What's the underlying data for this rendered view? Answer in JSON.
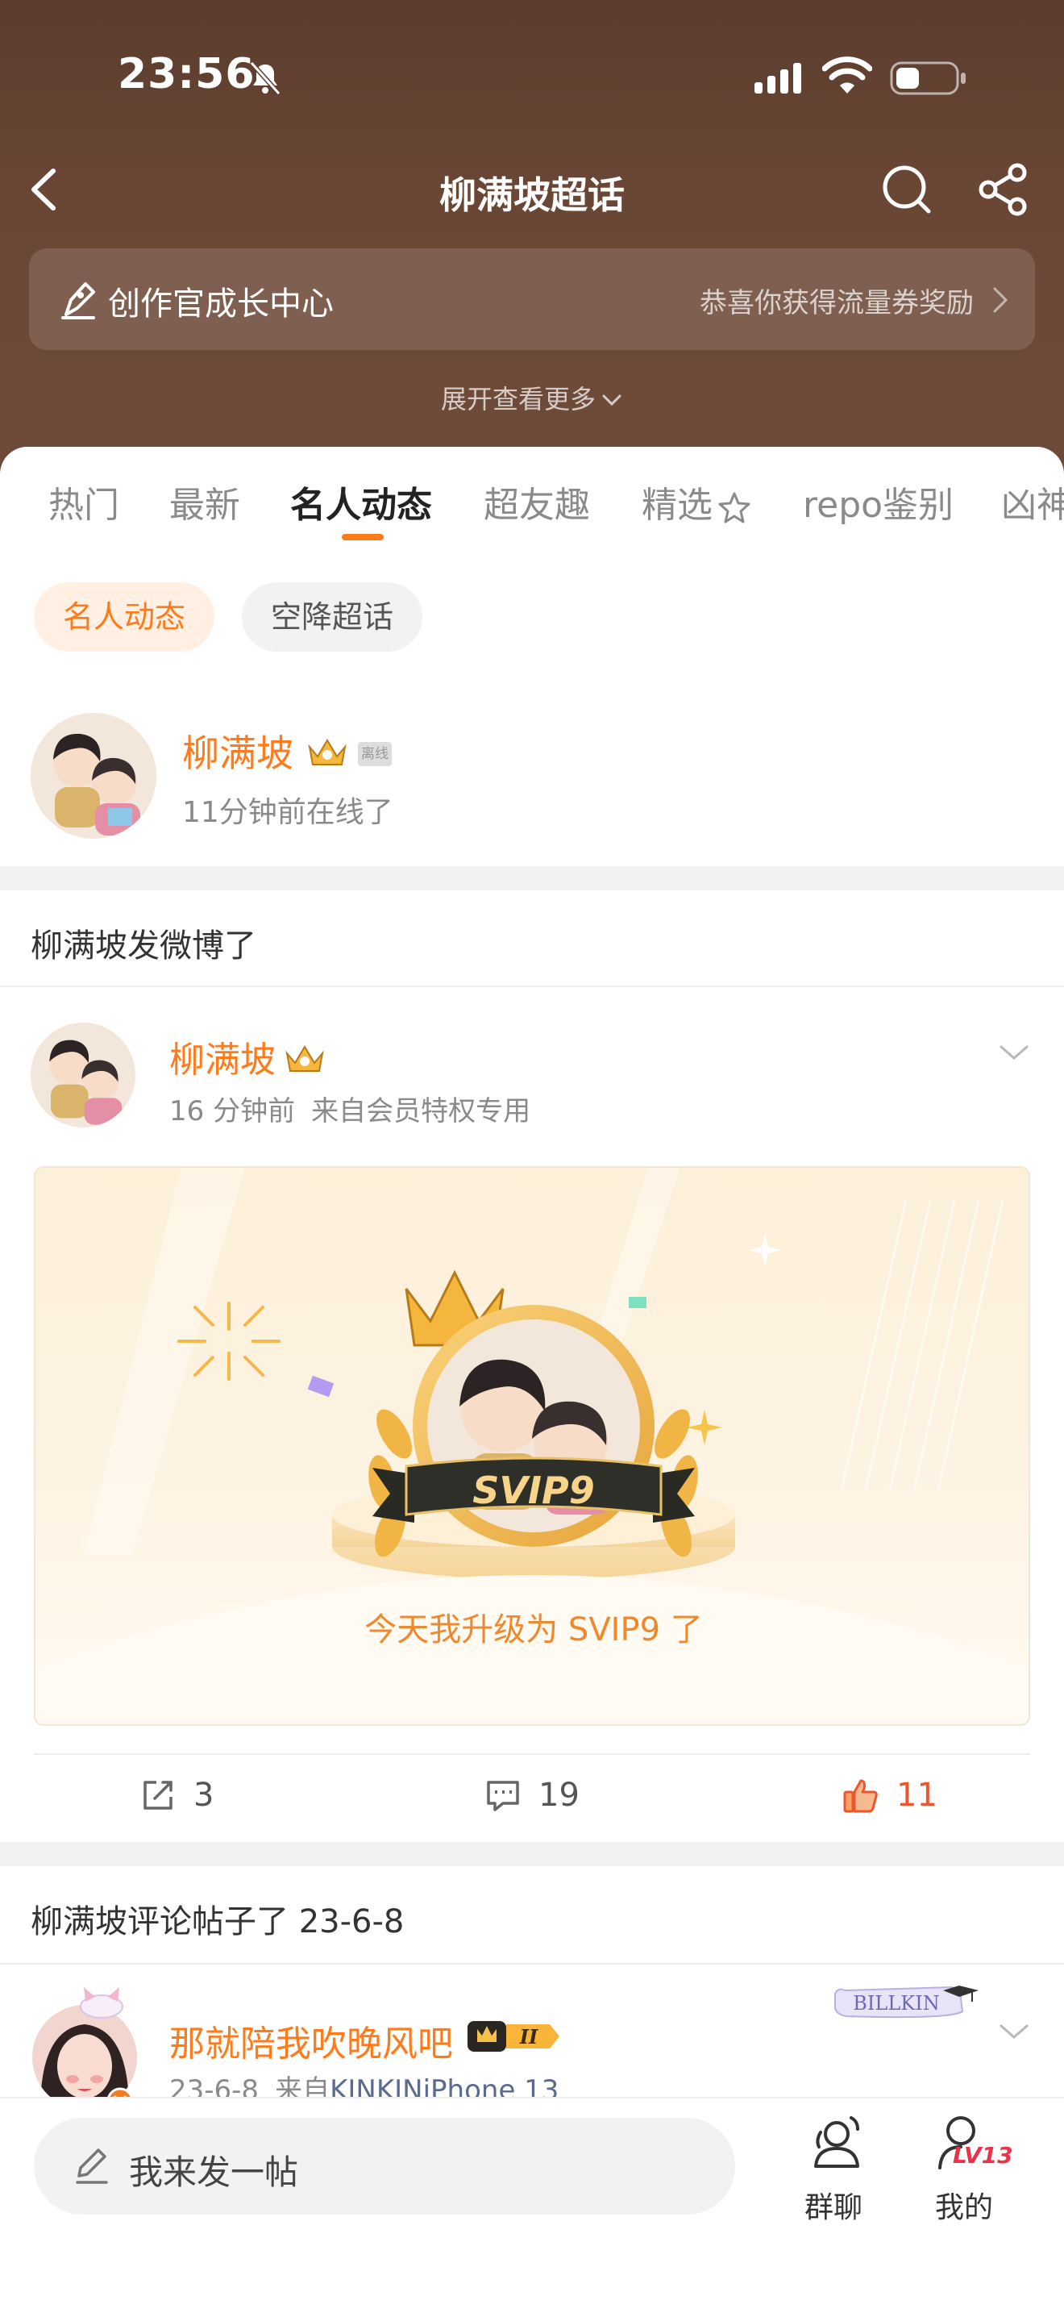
{
  "status_bar": {
    "time": "23:56"
  },
  "header": {
    "title": "柳满坡超话",
    "growth_banner": {
      "title": "创作官成长中心",
      "reward": "恭喜你获得流量券奖励"
    },
    "expand_more": "展开查看更多"
  },
  "tabs": [
    {
      "label": "热门",
      "active": false
    },
    {
      "label": "最新",
      "active": false
    },
    {
      "label": "名人动态",
      "active": true
    },
    {
      "label": "超友趣",
      "active": false
    },
    {
      "label": "精选",
      "active": false
    },
    {
      "label": "repo鉴别",
      "active": false
    },
    {
      "label": "凶神",
      "active": false
    }
  ],
  "chips": [
    {
      "label": "名人动态",
      "active": true
    },
    {
      "label": "空降超话",
      "active": false
    }
  ],
  "celebrity": {
    "name": "柳满坡",
    "offline_tag": "离线",
    "status": "11分钟前在线了"
  },
  "section_weibo": {
    "title": "柳满坡发微博了"
  },
  "post1": {
    "author": "柳满坡",
    "time": "16 分钟前",
    "source": "来自会员特权专用",
    "card_badge": "SVIP9",
    "card_caption": "今天我升级为 SVIP9 了",
    "reposts": "3",
    "comments": "19",
    "likes": "11"
  },
  "section_comment": {
    "title": "柳满坡评论帖子了 23-6-8"
  },
  "post2": {
    "author": "那就陪我吹晚风吧",
    "time": "23-6-8",
    "source_prefix": "来自",
    "device": "KINKINiPhone 13",
    "badge": "BILLKIN",
    "level_badge": "II"
  },
  "bottom_bar": {
    "compose_placeholder": "我来发一帖",
    "group_chat": "群聊",
    "mine": "我的",
    "level": "LV13"
  },
  "colors": {
    "accent": "#ff7a1a",
    "header_brown": "#6a4635",
    "like_red": "#f0542d"
  }
}
